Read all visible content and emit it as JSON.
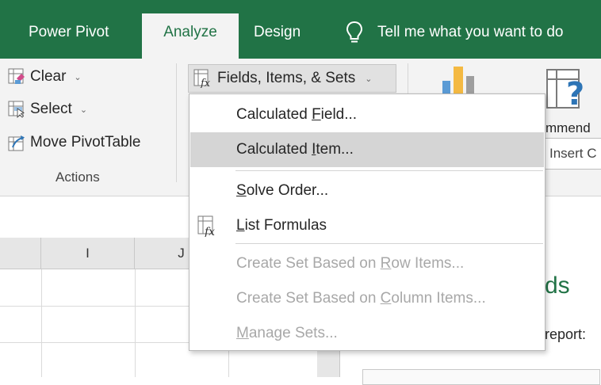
{
  "tabs": {
    "power_pivot": "Power Pivot",
    "analyze": "Analyze",
    "design": "Design",
    "tell_me": "Tell me what you want to do"
  },
  "ribbon": {
    "clear": "Clear",
    "select": "Select",
    "move_pivottable": "Move PivotTable",
    "actions_group": "Actions",
    "fields_items_sets": "Fields, Items, & Sets",
    "recommended_partial": "mmend",
    "tooltip_partial": "Insert C"
  },
  "menu": {
    "calculated_field": {
      "pre": "Calculated ",
      "key": "F",
      "post": "ield..."
    },
    "calculated_item": {
      "pre": "Calculated ",
      "key": "I",
      "post": "tem..."
    },
    "solve_order": {
      "pre": "",
      "key": "S",
      "post": "olve Order..."
    },
    "list_formulas": {
      "pre": "",
      "key": "L",
      "post": "ist Formulas"
    },
    "create_set_rows": {
      "pre": "Create Set Based on ",
      "key": "R",
      "post": "ow Items..."
    },
    "create_set_cols": {
      "pre": "Create Set Based on ",
      "key": "C",
      "post": "olumn Items..."
    },
    "manage_sets": {
      "pre": "",
      "key": "M",
      "post": "anage Sets..."
    }
  },
  "grid": {
    "col_i": "I",
    "col_j": "J"
  },
  "pane": {
    "heading_partial": "ds",
    "text_partial": "report:"
  },
  "colors": {
    "ribbon_green": "#217346",
    "ribbon_bg": "#f3f3f3",
    "menu_hover": "#d5d5d5",
    "disabled_text": "#a8a8a8"
  },
  "icons": [
    "lightbulb-icon",
    "clear-icon",
    "select-icon",
    "move-pivottable-icon",
    "formula-icon",
    "pivotchart-icon",
    "recommended-pivottables-icon",
    "chevron-down-icon"
  ]
}
